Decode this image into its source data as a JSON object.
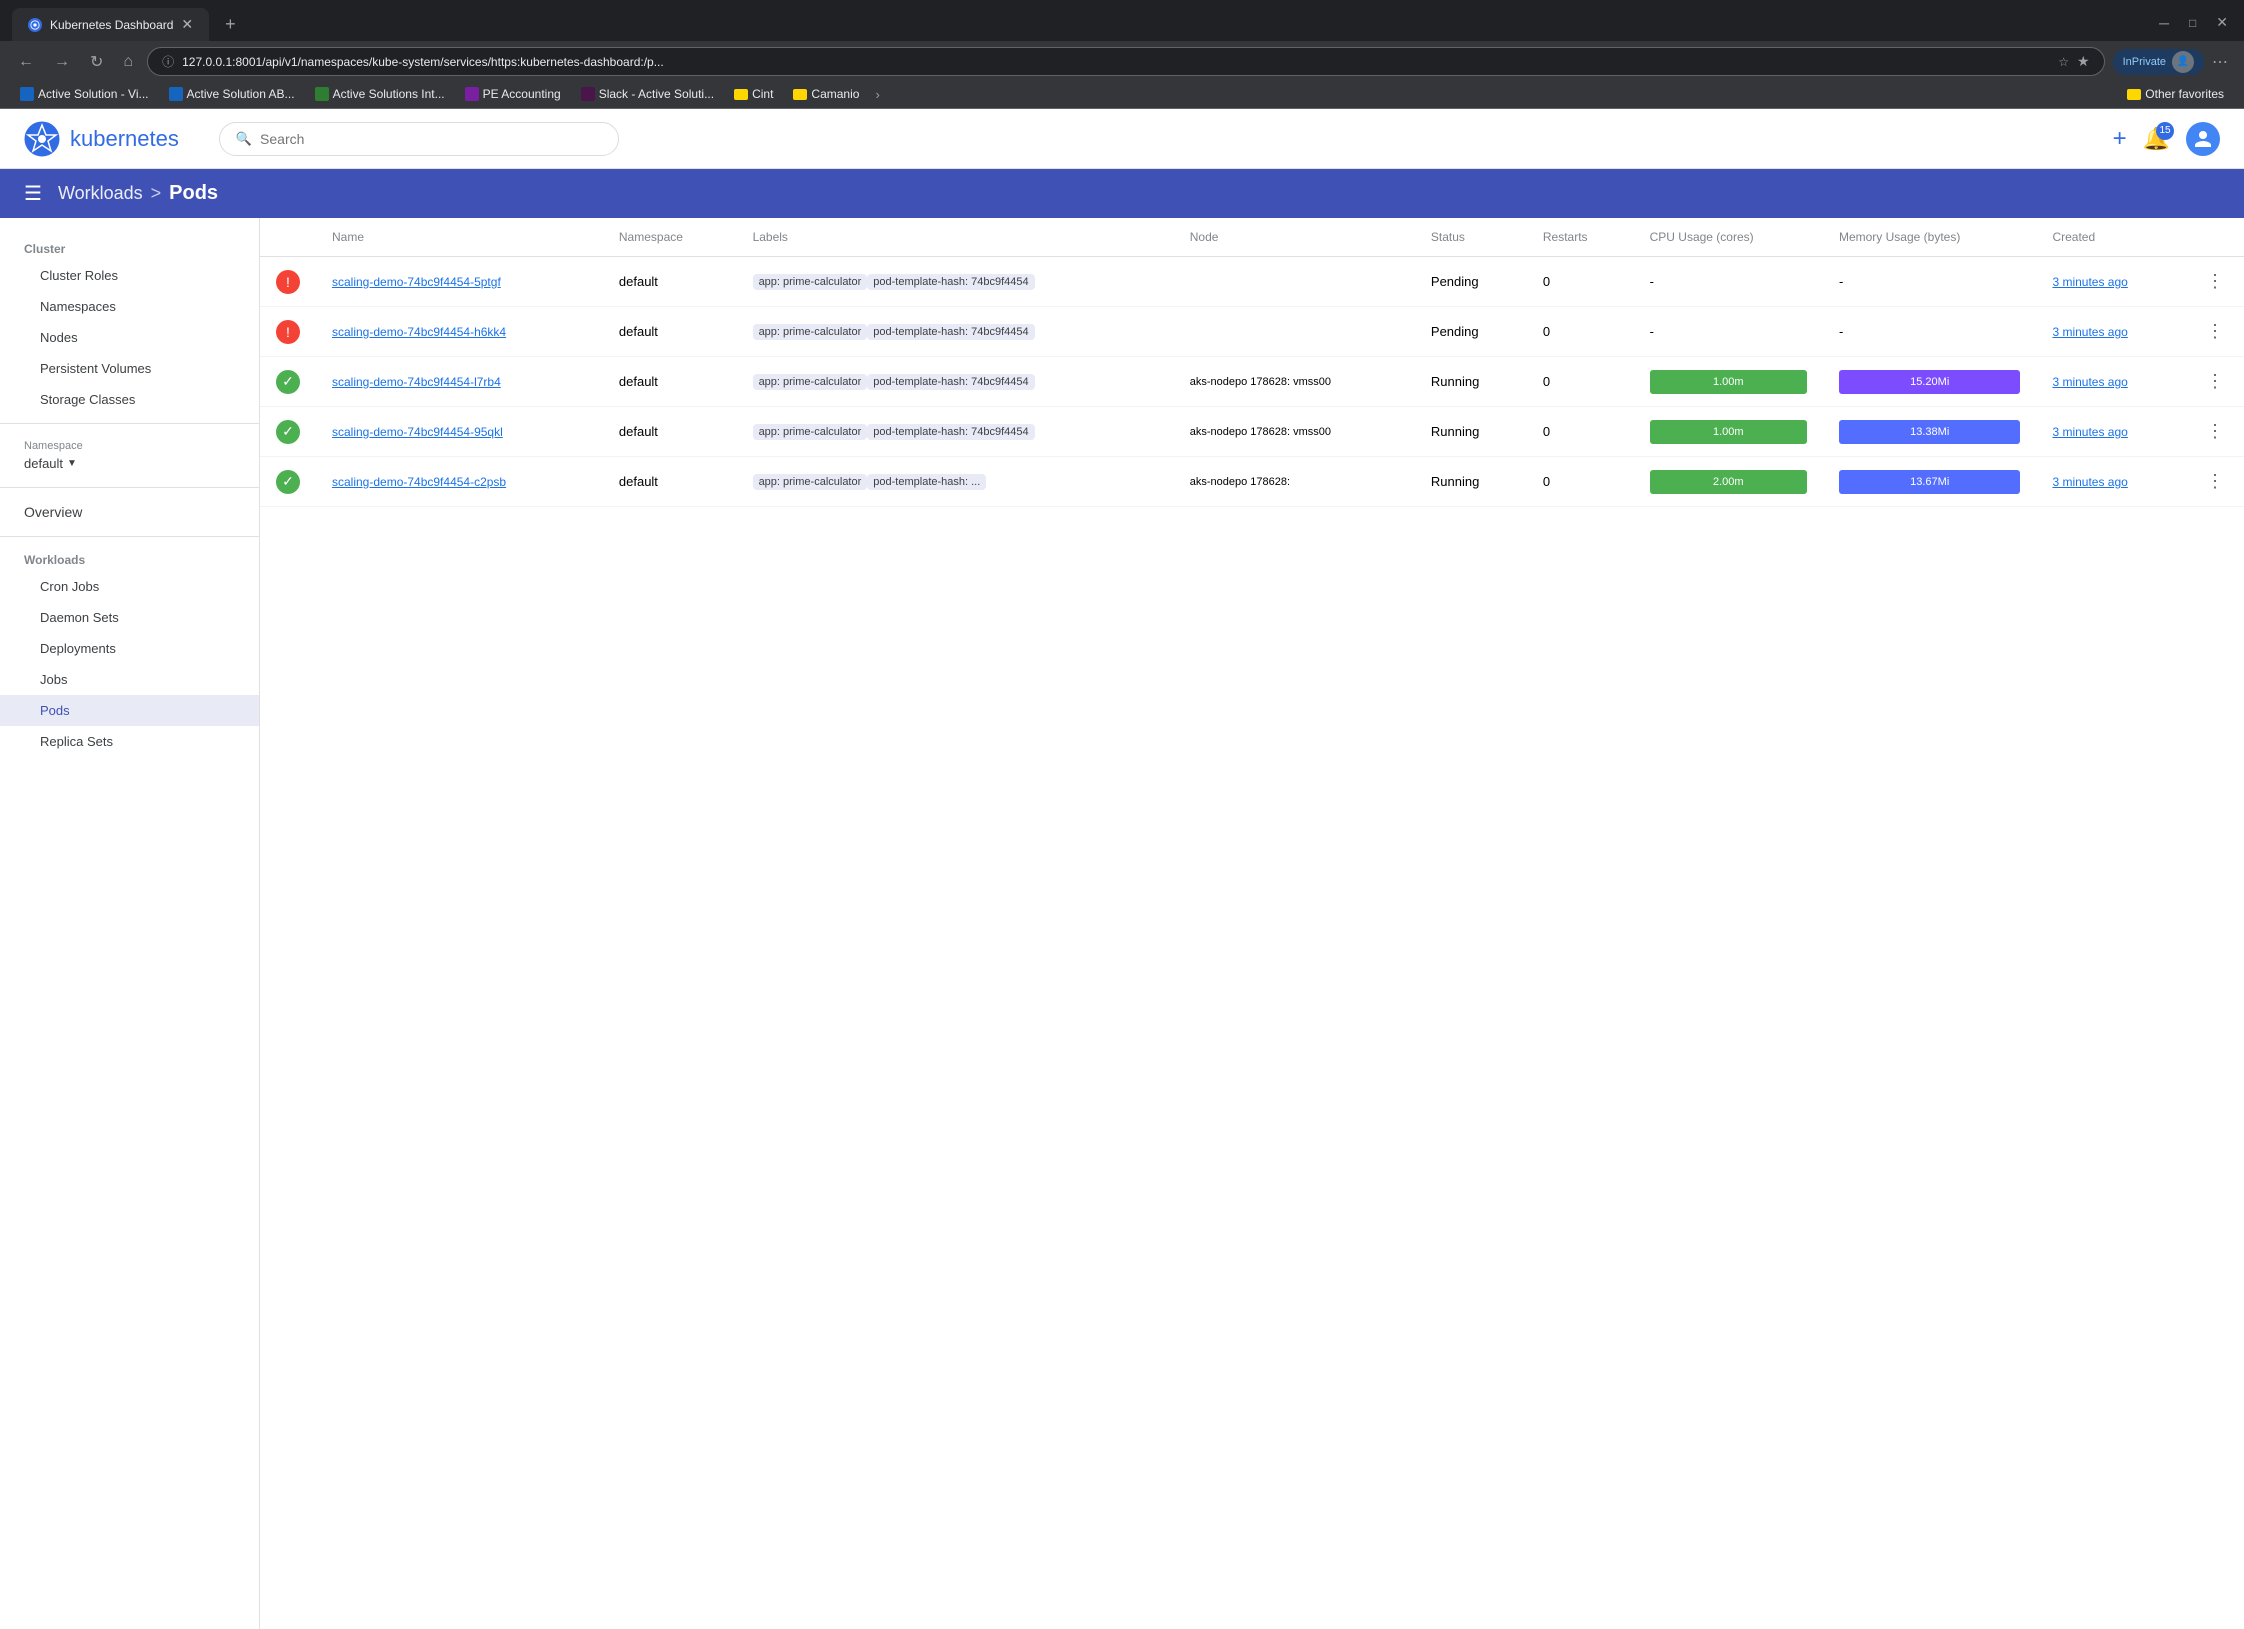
{
  "browser": {
    "tab": {
      "title": "Kubernetes Dashboard",
      "favicon_color": "#326ce5"
    },
    "address": "127.0.0.1:8001/api/v1/namespaces/kube-system/services/https:kubernetes-dashboard:/p...",
    "bookmarks": [
      {
        "id": "bm1",
        "label": "Active Solution - Vi...",
        "favicon_color": "#1565c0"
      },
      {
        "id": "bm2",
        "label": "Active Solution AB...",
        "favicon_color": "#1565c0"
      },
      {
        "id": "bm3",
        "label": "Active Solutions Int...",
        "favicon_color": "#2e7d32"
      },
      {
        "id": "bm4",
        "label": "PE Accounting",
        "favicon_color": "#7b1fa2"
      },
      {
        "id": "bm5",
        "label": "Slack - Active Soluti...",
        "favicon_color": "#4a154b"
      },
      {
        "id": "bm6",
        "label": "Cint",
        "is_folder": true
      },
      {
        "id": "bm7",
        "label": "Camanio",
        "is_folder": true
      },
      {
        "id": "bm8",
        "label": "Other favorites",
        "is_folder": true
      }
    ],
    "in_private_label": "InPrivate"
  },
  "app": {
    "logo_text": "kubernetes",
    "search_placeholder": "Search",
    "header_actions": {
      "notifications_count": "15"
    }
  },
  "breadcrumb": {
    "workloads_label": "Workloads",
    "separator": ">",
    "pods_label": "Pods"
  },
  "sidebar": {
    "cluster_label": "Cluster",
    "cluster_items": [
      {
        "id": "cluster-roles",
        "label": "Cluster Roles"
      },
      {
        "id": "namespaces",
        "label": "Namespaces"
      },
      {
        "id": "nodes",
        "label": "Nodes"
      },
      {
        "id": "persistent-volumes",
        "label": "Persistent Volumes"
      },
      {
        "id": "storage-classes",
        "label": "Storage Classes"
      }
    ],
    "namespace_label": "Namespace",
    "namespace_value": "default",
    "overview_label": "Overview",
    "workloads_label": "Workloads",
    "workload_items": [
      {
        "id": "cron-jobs",
        "label": "Cron Jobs"
      },
      {
        "id": "daemon-sets",
        "label": "Daemon Sets"
      },
      {
        "id": "deployments",
        "label": "Deployments"
      },
      {
        "id": "jobs",
        "label": "Jobs"
      },
      {
        "id": "pods",
        "label": "Pods",
        "active": true
      },
      {
        "id": "replica-sets",
        "label": "Replica Sets"
      }
    ]
  },
  "table": {
    "columns": [
      "Name",
      "Namespace",
      "Labels",
      "Node",
      "Status",
      "Restarts",
      "CPU Usage (cores)",
      "Memory Usage (bytes)",
      "Created"
    ],
    "rows": [
      {
        "status_type": "error",
        "name": "scaling-demo-74bc9f4454-5ptgf",
        "namespace": "default",
        "labels": [
          "app: prime-calculator",
          "pod-template-hash: 74bc9f4454"
        ],
        "node": "",
        "status": "Pending",
        "restarts": "0",
        "cpu": "-",
        "memory": "-",
        "created": "3 minutes ago",
        "has_cpu_bar": false,
        "has_mem_bar": false
      },
      {
        "status_type": "error",
        "name": "scaling-demo-74bc9f4454-h6kk4",
        "namespace": "default",
        "labels": [
          "app: prime-calculator",
          "pod-template-hash: 74bc9f4454"
        ],
        "node": "",
        "status": "Pending",
        "restarts": "0",
        "cpu": "-",
        "memory": "-",
        "created": "3 minutes ago",
        "has_cpu_bar": false,
        "has_mem_bar": false
      },
      {
        "status_type": "success",
        "name": "scaling-demo-74bc9f4454-l7rb4",
        "namespace": "default",
        "labels": [
          "app: prime-calculator",
          "pod-template-hash: 74bc9f4454"
        ],
        "node": "aks-nodepo 178628: vmss00",
        "status": "Running",
        "restarts": "0",
        "cpu": "1.00m",
        "memory": "15.20Mi",
        "created": "3 minutes ago",
        "has_cpu_bar": true,
        "has_mem_bar": true,
        "mem_bar_variant": "purple"
      },
      {
        "status_type": "success",
        "name": "scaling-demo-74bc9f4454-95qkl",
        "namespace": "default",
        "labels": [
          "app: prime-calculator",
          "pod-template-hash: 74bc9f4454"
        ],
        "node": "aks-nodepo 178628: vmss00",
        "status": "Running",
        "restarts": "0",
        "cpu": "1.00m",
        "memory": "13.38Mi",
        "created": "3 minutes ago",
        "has_cpu_bar": true,
        "has_mem_bar": true,
        "mem_bar_variant": "blue"
      },
      {
        "status_type": "success",
        "name": "scaling-demo-74bc9f4454-c2psb",
        "namespace": "default",
        "labels": [
          "app: prime-calculator",
          "pod-template-hash: ..."
        ],
        "node": "aks-nodepo 178628:",
        "status": "Running",
        "restarts": "0",
        "cpu": "2.00m",
        "memory": "13.67Mi",
        "created": "3 minutes ago",
        "has_cpu_bar": true,
        "has_mem_bar": true,
        "mem_bar_variant": "blue"
      }
    ]
  }
}
